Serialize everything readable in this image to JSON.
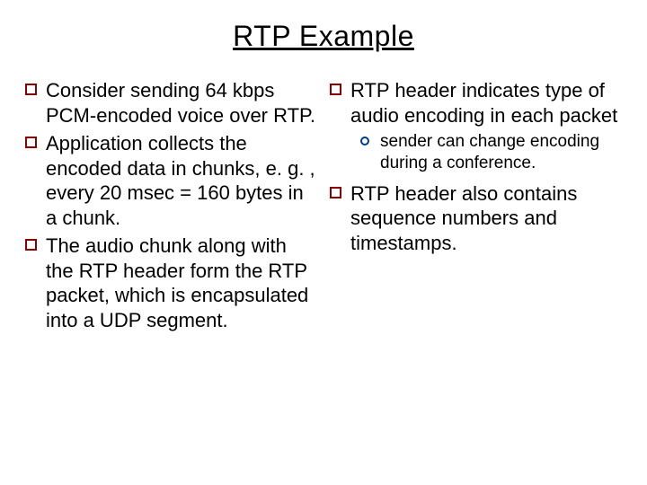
{
  "title": "RTP Example",
  "left": {
    "items": [
      "Consider sending 64 kbps PCM-encoded voice over RTP.",
      "Application collects the encoded data in chunks, e. g. , every 20 msec = 160 bytes in a chunk.",
      "The audio chunk along with the RTP header form the RTP packet, which is encapsulated into a UDP segment."
    ]
  },
  "right": {
    "items": [
      {
        "text": "RTP header indicates type of audio encoding in each packet",
        "sub": [
          " sender can change encoding during a conference."
        ]
      },
      {
        "text": "RTP header also contains sequence numbers and timestamps."
      }
    ]
  }
}
